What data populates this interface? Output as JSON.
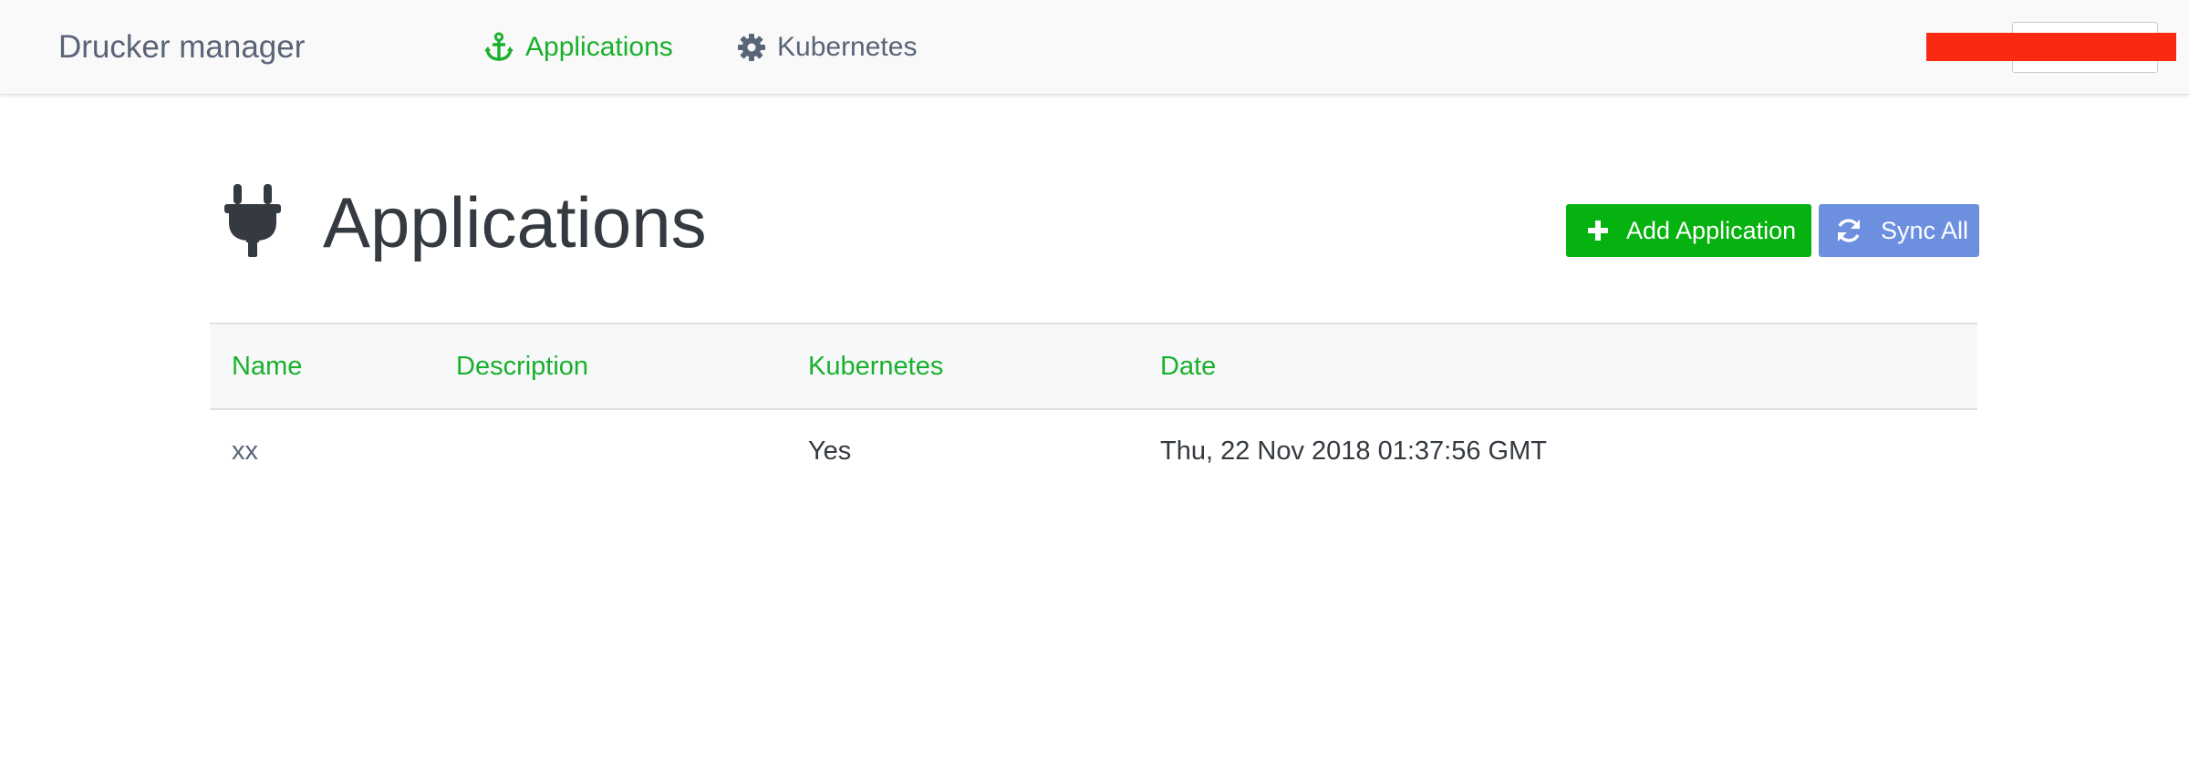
{
  "navbar": {
    "brand": "Drucker manager",
    "items": [
      {
        "label": "Applications",
        "icon": "anchor-icon",
        "active": true
      },
      {
        "label": "Kubernetes",
        "icon": "gear-icon",
        "active": false
      }
    ]
  },
  "page": {
    "title": "Applications",
    "icon": "plug-icon",
    "add_button_label": "Add Application",
    "add_button_icon": "plus-icon",
    "sync_button_label": "Sync All",
    "sync_button_icon": "sync-icon"
  },
  "table": {
    "headers": [
      "Name",
      "Description",
      "Kubernetes",
      "Date"
    ],
    "rows": [
      {
        "name": "xx",
        "description": "",
        "kubernetes": "Yes",
        "date": "Thu, 22 Nov 2018 01:37:56 GMT"
      }
    ]
  },
  "colors": {
    "accent_green": "#19b02c",
    "add_button": "#06b20f",
    "sync_button": "#6d8fe0",
    "redaction": "#fa2a12"
  }
}
